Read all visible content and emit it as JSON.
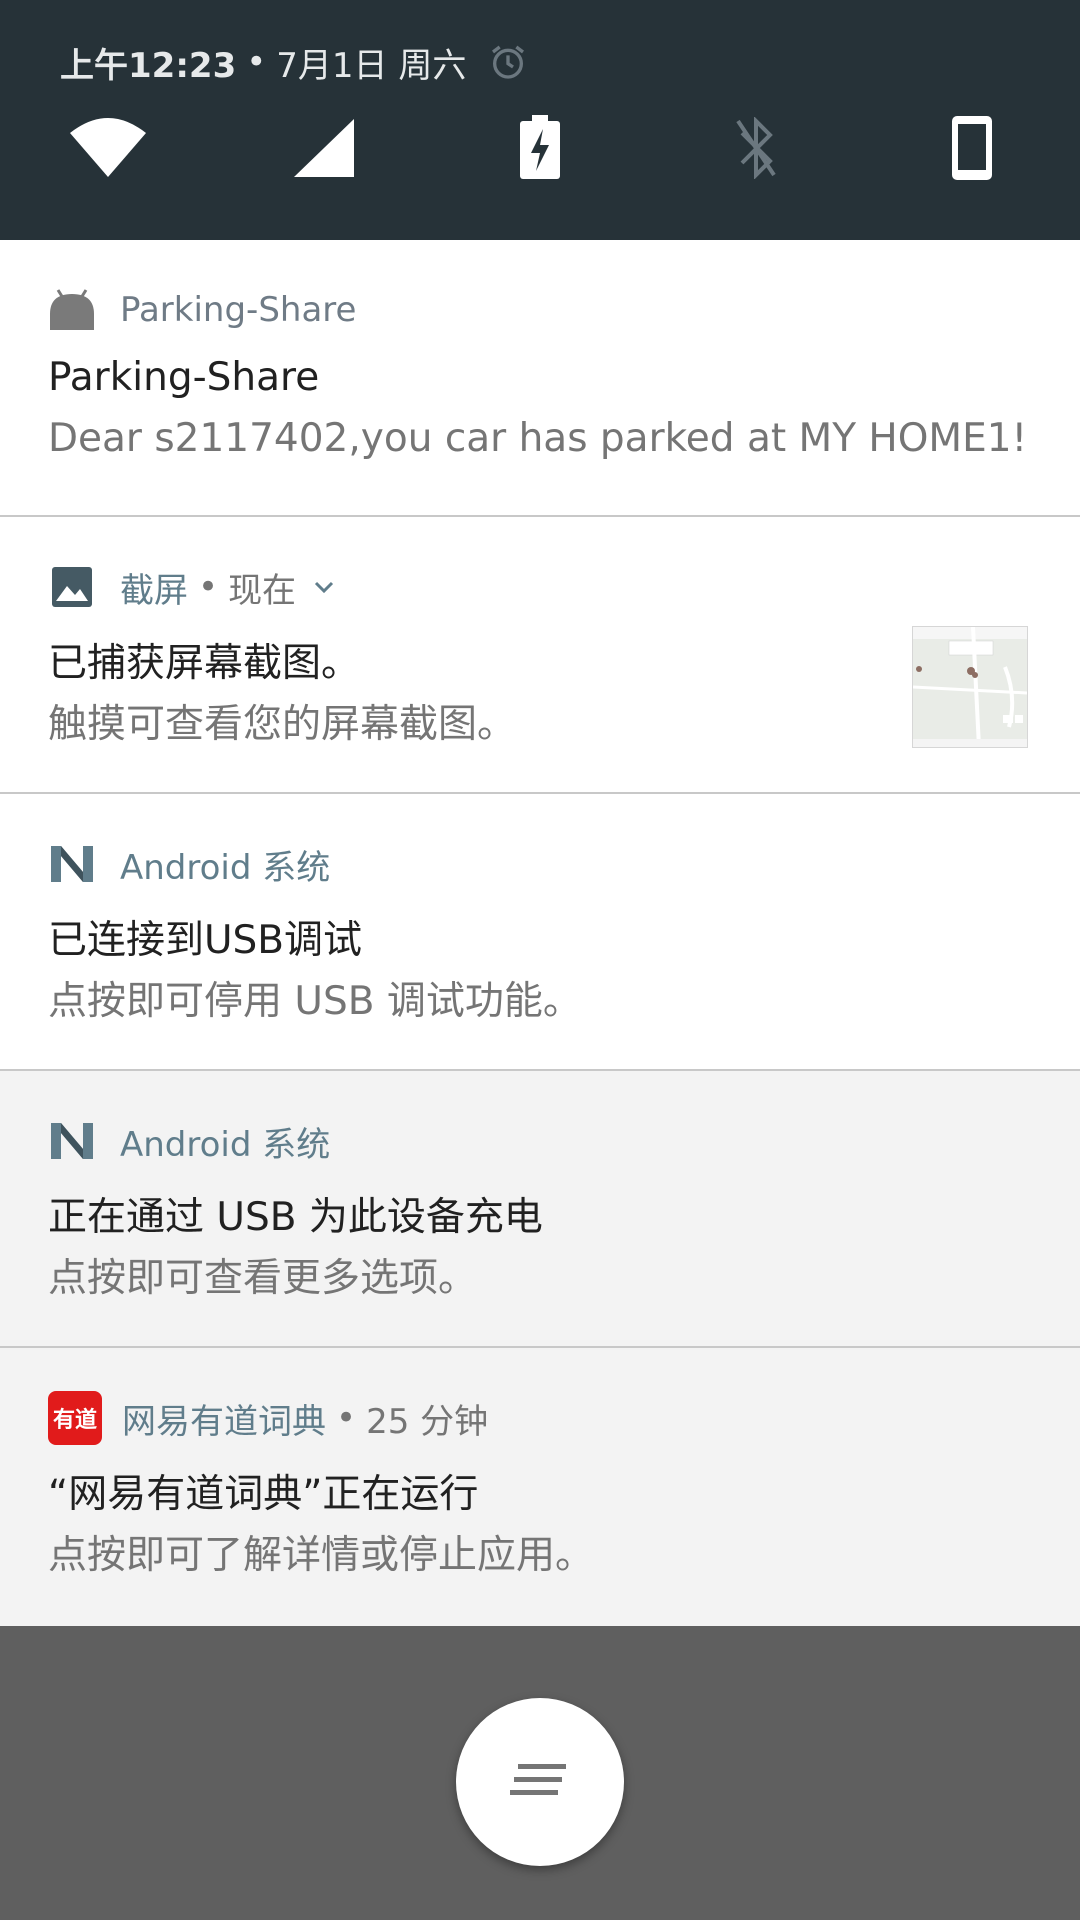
{
  "status_bar": {
    "time": "上午12:23",
    "separator": "•",
    "date": "7月1日 周六",
    "alarm_icon": "alarm-icon"
  },
  "quick_settings": [
    {
      "name": "wifi",
      "icon": "wifi-icon"
    },
    {
      "name": "cellular",
      "icon": "cellular-signal-icon"
    },
    {
      "name": "battery",
      "icon": "battery-charging-icon"
    },
    {
      "name": "bluetooth",
      "icon": "bluetooth-icon"
    },
    {
      "name": "rotation",
      "icon": "portrait-phone-icon"
    }
  ],
  "notifications": [
    {
      "app_icon": "android-head-icon",
      "app_name": "Parking-Share",
      "title": "Parking-Share",
      "text": "Dear s2117402,you car has parked at MY HOME1!"
    },
    {
      "app_icon": "image-icon",
      "app_name": "截屏",
      "separator": "•",
      "time": "现在",
      "expand_icon": "chevron-down-icon",
      "title": "已捕获屏幕截图。",
      "text": "触摸可查看您的屏幕截图。",
      "thumbnail": "screenshot-thumbnail"
    },
    {
      "app_icon": "android-n-icon",
      "app_name": "Android 系统",
      "title": "已连接到USB调试",
      "text": "点按即可停用 USB 调试功能。"
    },
    {
      "app_icon": "android-n-icon",
      "app_name": "Android 系统",
      "title": "正在通过 USB 为此设备充电",
      "text": "点按即可查看更多选项。"
    },
    {
      "app_icon": "youdao-icon",
      "app_icon_text": "有道",
      "app_name": "网易有道词典",
      "separator": "•",
      "time": "25 分钟",
      "title": "“网易有道词典”正在运行",
      "text": "点按即可了解详情或停止应用。"
    }
  ],
  "fab": {
    "icon": "notification-list-icon"
  },
  "colors": {
    "header_bg": "#263238",
    "teal_text": "#607d8b",
    "scrim": "#5f5f5f",
    "youdao_red": "#e11b1b"
  }
}
